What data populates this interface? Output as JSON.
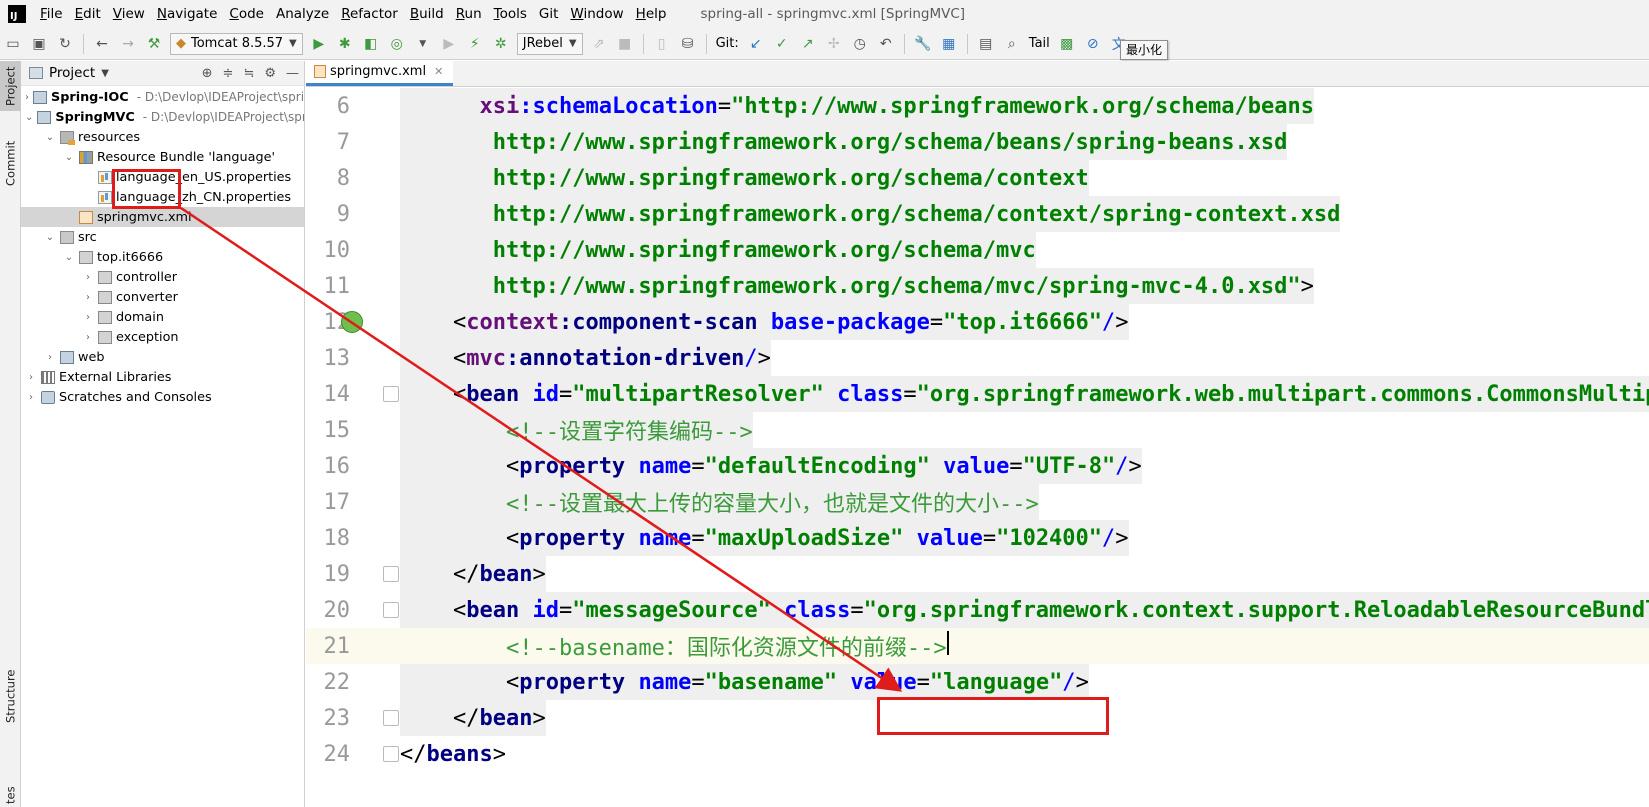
{
  "menubar": {
    "app_logo": "IJ",
    "items": [
      {
        "label": "File",
        "mnemonic": "F",
        "rest": "ile"
      },
      {
        "label": "Edit",
        "mnemonic": "E",
        "rest": "dit"
      },
      {
        "label": "View",
        "mnemonic": "V",
        "rest": "iew"
      },
      {
        "label": "Navigate",
        "mnemonic": "N",
        "rest": "avigate"
      },
      {
        "label": "Code",
        "mnemonic": "C",
        "rest": "ode"
      },
      {
        "label": "Analyze",
        "mnemonic": "",
        "rest": "Analyze"
      },
      {
        "label": "Refactor",
        "mnemonic": "R",
        "rest": "efactor"
      },
      {
        "label": "Build",
        "mnemonic": "B",
        "rest": "uild"
      },
      {
        "label": "Run",
        "mnemonic": "R",
        "rest": "un"
      },
      {
        "label": "Tools",
        "mnemonic": "T",
        "rest": "ools"
      },
      {
        "label": "Git",
        "mnemonic": "",
        "rest": "Git"
      },
      {
        "label": "Window",
        "mnemonic": "W",
        "rest": "indow"
      },
      {
        "label": "Help",
        "mnemonic": "H",
        "rest": "elp"
      }
    ],
    "title": "spring-all - springmvc.xml [SpringMVC]"
  },
  "toolbar": {
    "run_config": "Tomcat 8.5.57",
    "jrebel": "JRebel",
    "git_label": "Git:",
    "tail_label": "Tail",
    "tooltip": "最小化"
  },
  "left_strip": {
    "project_tab": "Project",
    "commit_tab": "Commit",
    "structure_tab": "Structure",
    "bottom_tab": "tes"
  },
  "project_panel": {
    "title": "Project",
    "tree": [
      {
        "label": "Spring-IOC",
        "path": "- D:\\Devlop\\IDEAProject\\spri",
        "depth": 0,
        "expanded": false,
        "icon": "module-icon",
        "bold": true
      },
      {
        "label": "SpringMVC",
        "path": "- D:\\Devlop\\IDEAProject\\spr",
        "depth": 0,
        "expanded": true,
        "icon": "module-icon",
        "bold": true
      },
      {
        "label": "resources",
        "depth": 1,
        "expanded": true,
        "icon": "resources-folder-icon"
      },
      {
        "label": "Resource Bundle 'language'",
        "depth": 2,
        "expanded": true,
        "icon": "resource-bundle-icon"
      },
      {
        "label": "language_en_US.properties",
        "depth": 3,
        "icon": "properties-file-icon"
      },
      {
        "label": "language_zh_CN.properties",
        "depth": 3,
        "icon": "properties-file-icon"
      },
      {
        "label": "springmvc.xml",
        "depth": 2,
        "icon": "xml-file-icon",
        "selected": true
      },
      {
        "label": "src",
        "depth": 1,
        "expanded": true,
        "icon": "source-folder-icon"
      },
      {
        "label": "top.it6666",
        "depth": 2,
        "expanded": true,
        "icon": "package-icon"
      },
      {
        "label": "controller",
        "depth": 3,
        "expanded": false,
        "icon": "package-icon"
      },
      {
        "label": "converter",
        "depth": 3,
        "expanded": false,
        "icon": "package-icon"
      },
      {
        "label": "domain",
        "depth": 3,
        "expanded": false,
        "icon": "package-icon"
      },
      {
        "label": "exception",
        "depth": 3,
        "expanded": false,
        "icon": "package-icon"
      },
      {
        "label": "web",
        "depth": 1,
        "expanded": false,
        "icon": "web-folder-icon"
      },
      {
        "label": "External Libraries",
        "depth": 0,
        "expanded": false,
        "icon": "libraries-icon"
      },
      {
        "label": "Scratches and Consoles",
        "depth": 0,
        "expanded": false,
        "icon": "scratches-icon"
      }
    ]
  },
  "editor": {
    "tab_label": "springmvc.xml",
    "lines": [
      {
        "num": "6",
        "tokens": [
          [
            "plain",
            "      "
          ],
          [
            "attrns",
            "xsi"
          ],
          [
            "attr",
            ":schemaLocation"
          ],
          [
            "plain",
            "="
          ],
          [
            "val",
            "\"http://www.springframework.org/schema/beans"
          ]
        ]
      },
      {
        "num": "7",
        "tokens": [
          [
            "plain",
            "       "
          ],
          [
            "val",
            "http://www.springframework.org/schema/beans/spring-beans.xsd"
          ]
        ]
      },
      {
        "num": "8",
        "tokens": [
          [
            "plain",
            "       "
          ],
          [
            "val",
            "http://www.springframework.org/schema/context"
          ]
        ]
      },
      {
        "num": "9",
        "tokens": [
          [
            "plain",
            "       "
          ],
          [
            "val",
            "http://www.springframework.org/schema/context/spring-context.xsd"
          ]
        ]
      },
      {
        "num": "10",
        "tokens": [
          [
            "plain",
            "       "
          ],
          [
            "val",
            "http://www.springframework.org/schema/mvc"
          ]
        ]
      },
      {
        "num": "11",
        "tokens": [
          [
            "plain",
            "       "
          ],
          [
            "val",
            "http://www.springframework.org/schema/mvc/spring-mvc-4.0.xsd\""
          ],
          [
            "plain",
            ">"
          ]
        ]
      },
      {
        "num": "12",
        "tokens": [
          [
            "plain",
            "    <"
          ],
          [
            "ns",
            "context"
          ],
          [
            "tag",
            ":component-scan "
          ],
          [
            "attr",
            "base-package"
          ],
          [
            "plain",
            "="
          ],
          [
            "val",
            "\"top.it6666\""
          ],
          [
            "slash",
            "/"
          ],
          [
            "plain",
            ">"
          ]
        ]
      },
      {
        "num": "13",
        "tokens": [
          [
            "plain",
            "    <"
          ],
          [
            "ns",
            "mvc"
          ],
          [
            "tag",
            ":annotation-driven"
          ],
          [
            "slash",
            "/"
          ],
          [
            "plain",
            ">"
          ]
        ]
      },
      {
        "num": "14",
        "tokens": [
          [
            "plain",
            "    <"
          ],
          [
            "tag",
            "bean "
          ],
          [
            "attr",
            "id"
          ],
          [
            "plain",
            "="
          ],
          [
            "val",
            "\"multipartResolver\" "
          ],
          [
            "attr",
            "class"
          ],
          [
            "plain",
            "="
          ],
          [
            "val",
            "\"org.springframework.web.multipart.commons.CommonsMultipartResolver\""
          ],
          [
            "plain",
            ">"
          ]
        ]
      },
      {
        "num": "15",
        "tokens": [
          [
            "plain",
            "        "
          ],
          [
            "comment",
            "<!--设置字符集编码-->"
          ]
        ]
      },
      {
        "num": "16",
        "tokens": [
          [
            "plain",
            "        <"
          ],
          [
            "tag",
            "property "
          ],
          [
            "attr",
            "name"
          ],
          [
            "plain",
            "="
          ],
          [
            "val",
            "\"defaultEncoding\" "
          ],
          [
            "attr",
            "value"
          ],
          [
            "plain",
            "="
          ],
          [
            "val",
            "\"UTF-8\""
          ],
          [
            "slash",
            "/"
          ],
          [
            "plain",
            ">"
          ]
        ]
      },
      {
        "num": "17",
        "tokens": [
          [
            "plain",
            "        "
          ],
          [
            "comment",
            "<!--设置最大上传的容量大小，也就是文件的大小-->"
          ]
        ]
      },
      {
        "num": "18",
        "tokens": [
          [
            "plain",
            "        <"
          ],
          [
            "tag",
            "property "
          ],
          [
            "attr",
            "name"
          ],
          [
            "plain",
            "="
          ],
          [
            "val",
            "\"maxUploadSize\" "
          ],
          [
            "attr",
            "value"
          ],
          [
            "plain",
            "="
          ],
          [
            "val",
            "\"102400\""
          ],
          [
            "slash",
            "/"
          ],
          [
            "plain",
            ">"
          ]
        ]
      },
      {
        "num": "19",
        "tokens": [
          [
            "plain",
            "    </"
          ],
          [
            "tag",
            "bean"
          ],
          [
            "plain",
            ">"
          ]
        ]
      },
      {
        "num": "20",
        "tokens": [
          [
            "plain",
            "    <"
          ],
          [
            "tag",
            "bean "
          ],
          [
            "attr",
            "id"
          ],
          [
            "plain",
            "="
          ],
          [
            "val",
            "\"messageSource\" "
          ],
          [
            "attr",
            "class"
          ],
          [
            "plain",
            "="
          ],
          [
            "val",
            "\"org.springframework.context.support.ReloadableResourceBundleMessageSource\""
          ],
          [
            "plain",
            ">"
          ]
        ]
      },
      {
        "num": "21",
        "tokens": [
          [
            "plain",
            "        "
          ],
          [
            "comment",
            "<!--basename：国际化资源文件的前缀-->"
          ]
        ]
      },
      {
        "num": "22",
        "tokens": [
          [
            "plain",
            "        <"
          ],
          [
            "tag",
            "property "
          ],
          [
            "attr",
            "name"
          ],
          [
            "plain",
            "="
          ],
          [
            "val",
            "\"basename\" "
          ],
          [
            "attr",
            "value"
          ],
          [
            "plain",
            "="
          ],
          [
            "val",
            "\"language\""
          ],
          [
            "slash",
            "/"
          ],
          [
            "plain",
            ">"
          ]
        ]
      },
      {
        "num": "23",
        "tokens": [
          [
            "plain",
            "    </"
          ],
          [
            "tag",
            "bean"
          ],
          [
            "plain",
            ">"
          ]
        ]
      },
      {
        "num": "24",
        "tokens": [
          [
            "plain",
            "</"
          ],
          [
            "tag",
            "beans"
          ],
          [
            "plain",
            ">"
          ]
        ]
      }
    ]
  },
  "colors": {
    "annotation_red": "#e01b1b",
    "tab_underline": "#4083c9"
  }
}
